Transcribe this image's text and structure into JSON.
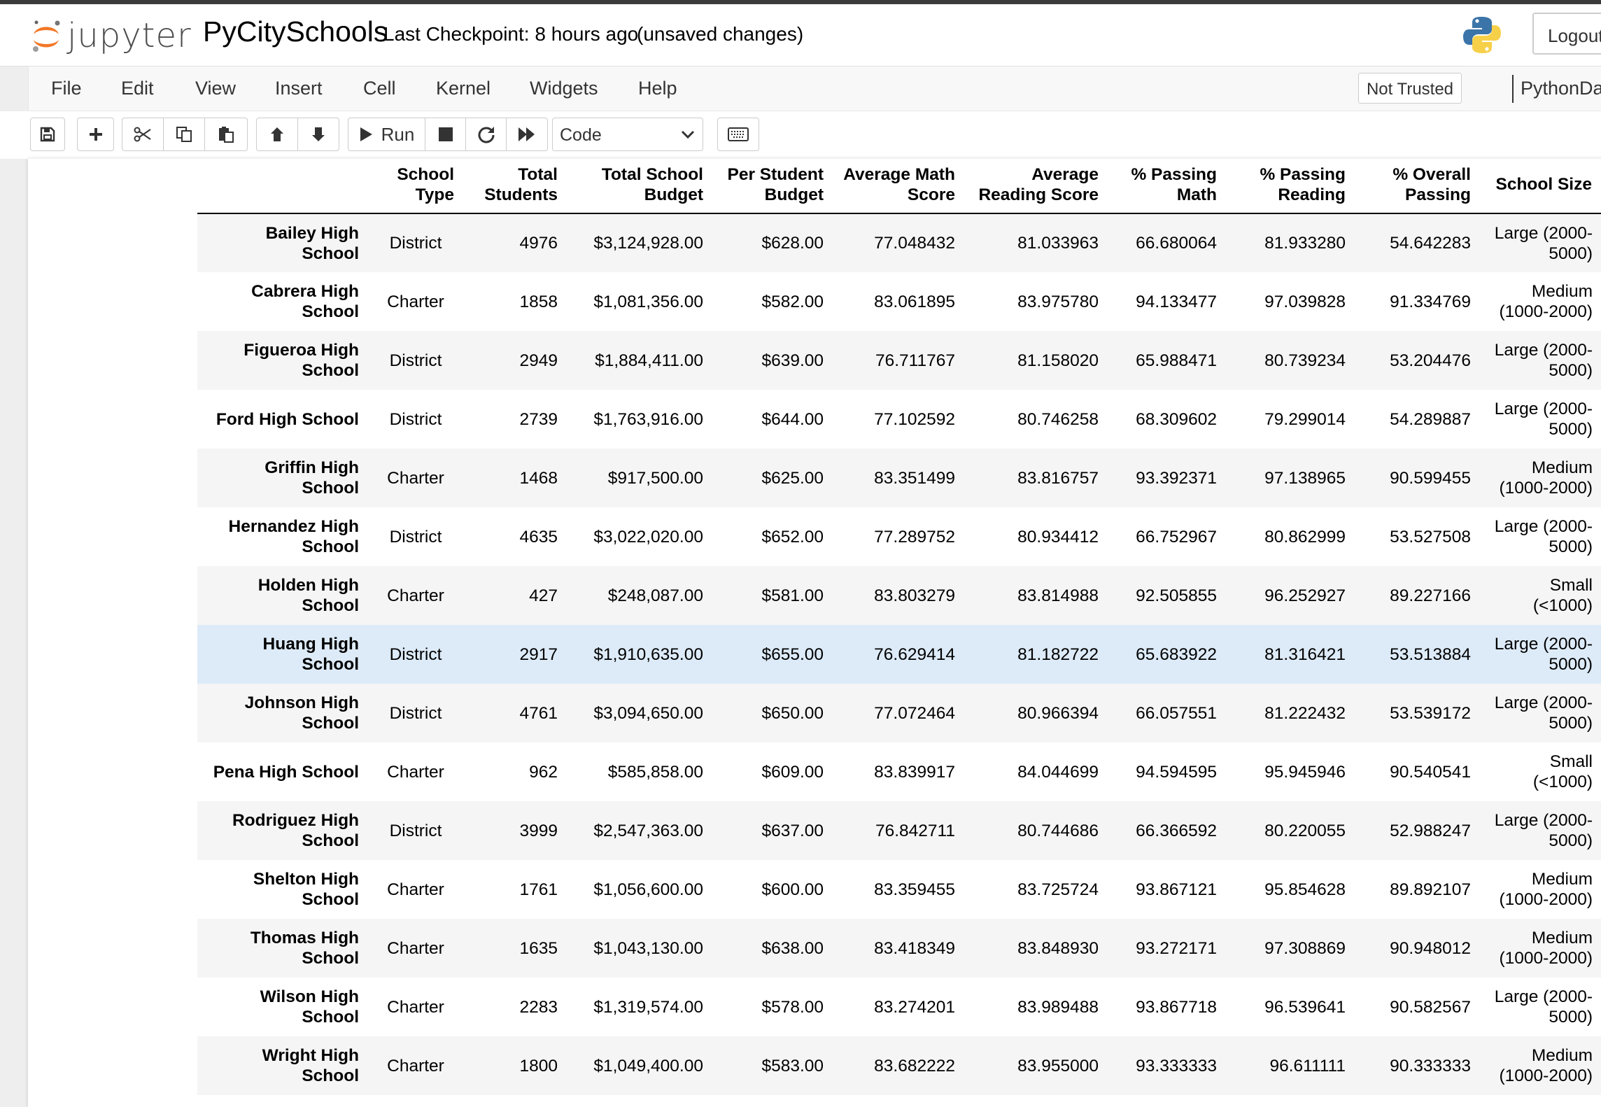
{
  "header": {
    "logo_text": "jupyter",
    "notebook_title": "PyCitySchools",
    "checkpoint": "Last Checkpoint: 8 hours ago",
    "unsaved": "(unsaved changes)",
    "logout_label": "Logout"
  },
  "menu": {
    "items": [
      "File",
      "Edit",
      "View",
      "Insert",
      "Cell",
      "Kernel",
      "Widgets",
      "Help"
    ],
    "trust_label": "Not Trusted",
    "kernel_name": "PythonData"
  },
  "toolbar": {
    "run_label": "Run",
    "cell_type": "Code",
    "icons": [
      "save-icon",
      "plus-icon",
      "cut-icon",
      "copy-icon",
      "paste-icon",
      "arrow-up-icon",
      "arrow-down-icon",
      "play-icon",
      "stop-icon",
      "restart-icon",
      "fast-forward-icon",
      "keyboard-icon"
    ]
  },
  "table": {
    "columns": [
      "School Type",
      "Total Students",
      "Total School Budget",
      "Per Student Budget",
      "Average Math Score",
      "Average Reading Score",
      "% Passing Math",
      "% Passing Reading",
      "% Overall Passing",
      "School Size"
    ],
    "rows": [
      {
        "name": "Bailey High School",
        "type": "District",
        "students": "4976",
        "budget": "$3,124,928.00",
        "per_student": "$628.00",
        "math": "77.048432",
        "reading": "81.033963",
        "pass_math": "66.680064",
        "pass_reading": "81.933280",
        "overall": "54.642283",
        "size": "Large (2000-5000)"
      },
      {
        "name": "Cabrera High School",
        "type": "Charter",
        "students": "1858",
        "budget": "$1,081,356.00",
        "per_student": "$582.00",
        "math": "83.061895",
        "reading": "83.975780",
        "pass_math": "94.133477",
        "pass_reading": "97.039828",
        "overall": "91.334769",
        "size": "Medium (1000-2000)"
      },
      {
        "name": "Figueroa High School",
        "type": "District",
        "students": "2949",
        "budget": "$1,884,411.00",
        "per_student": "$639.00",
        "math": "76.711767",
        "reading": "81.158020",
        "pass_math": "65.988471",
        "pass_reading": "80.739234",
        "overall": "53.204476",
        "size": "Large (2000-5000)"
      },
      {
        "name": "Ford High School",
        "type": "District",
        "students": "2739",
        "budget": "$1,763,916.00",
        "per_student": "$644.00",
        "math": "77.102592",
        "reading": "80.746258",
        "pass_math": "68.309602",
        "pass_reading": "79.299014",
        "overall": "54.289887",
        "size": "Large (2000-5000)"
      },
      {
        "name": "Griffin High School",
        "type": "Charter",
        "students": "1468",
        "budget": "$917,500.00",
        "per_student": "$625.00",
        "math": "83.351499",
        "reading": "83.816757",
        "pass_math": "93.392371",
        "pass_reading": "97.138965",
        "overall": "90.599455",
        "size": "Medium (1000-2000)"
      },
      {
        "name": "Hernandez High School",
        "type": "District",
        "students": "4635",
        "budget": "$3,022,020.00",
        "per_student": "$652.00",
        "math": "77.289752",
        "reading": "80.934412",
        "pass_math": "66.752967",
        "pass_reading": "80.862999",
        "overall": "53.527508",
        "size": "Large (2000-5000)"
      },
      {
        "name": "Holden High School",
        "type": "Charter",
        "students": "427",
        "budget": "$248,087.00",
        "per_student": "$581.00",
        "math": "83.803279",
        "reading": "83.814988",
        "pass_math": "92.505855",
        "pass_reading": "96.252927",
        "overall": "89.227166",
        "size": "Small (<1000)"
      },
      {
        "name": "Huang High School",
        "type": "District",
        "students": "2917",
        "budget": "$1,910,635.00",
        "per_student": "$655.00",
        "math": "76.629414",
        "reading": "81.182722",
        "pass_math": "65.683922",
        "pass_reading": "81.316421",
        "overall": "53.513884",
        "size": "Large (2000-5000)"
      },
      {
        "name": "Johnson High School",
        "type": "District",
        "students": "4761",
        "budget": "$3,094,650.00",
        "per_student": "$650.00",
        "math": "77.072464",
        "reading": "80.966394",
        "pass_math": "66.057551",
        "pass_reading": "81.222432",
        "overall": "53.539172",
        "size": "Large (2000-5000)"
      },
      {
        "name": "Pena High School",
        "type": "Charter",
        "students": "962",
        "budget": "$585,858.00",
        "per_student": "$609.00",
        "math": "83.839917",
        "reading": "84.044699",
        "pass_math": "94.594595",
        "pass_reading": "95.945946",
        "overall": "90.540541",
        "size": "Small (<1000)"
      },
      {
        "name": "Rodriguez High School",
        "type": "District",
        "students": "3999",
        "budget": "$2,547,363.00",
        "per_student": "$637.00",
        "math": "76.842711",
        "reading": "80.744686",
        "pass_math": "66.366592",
        "pass_reading": "80.220055",
        "overall": "52.988247",
        "size": "Large (2000-5000)"
      },
      {
        "name": "Shelton High School",
        "type": "Charter",
        "students": "1761",
        "budget": "$1,056,600.00",
        "per_student": "$600.00",
        "math": "83.359455",
        "reading": "83.725724",
        "pass_math": "93.867121",
        "pass_reading": "95.854628",
        "overall": "89.892107",
        "size": "Medium (1000-2000)"
      },
      {
        "name": "Thomas High School",
        "type": "Charter",
        "students": "1635",
        "budget": "$1,043,130.00",
        "per_student": "$638.00",
        "math": "83.418349",
        "reading": "83.848930",
        "pass_math": "93.272171",
        "pass_reading": "97.308869",
        "overall": "90.948012",
        "size": "Medium (1000-2000)"
      },
      {
        "name": "Wilson High School",
        "type": "Charter",
        "students": "2283",
        "budget": "$1,319,574.00",
        "per_student": "$578.00",
        "math": "83.274201",
        "reading": "83.989488",
        "pass_math": "93.867718",
        "pass_reading": "96.539641",
        "overall": "90.582567",
        "size": "Large (2000-5000)"
      },
      {
        "name": "Wright High School",
        "type": "Charter",
        "students": "1800",
        "budget": "$1,049,400.00",
        "per_student": "$583.00",
        "math": "83.682222",
        "reading": "83.955000",
        "pass_math": "93.333333",
        "pass_reading": "96.611111",
        "overall": "90.333333",
        "size": "Medium (1000-2000)"
      }
    ]
  }
}
